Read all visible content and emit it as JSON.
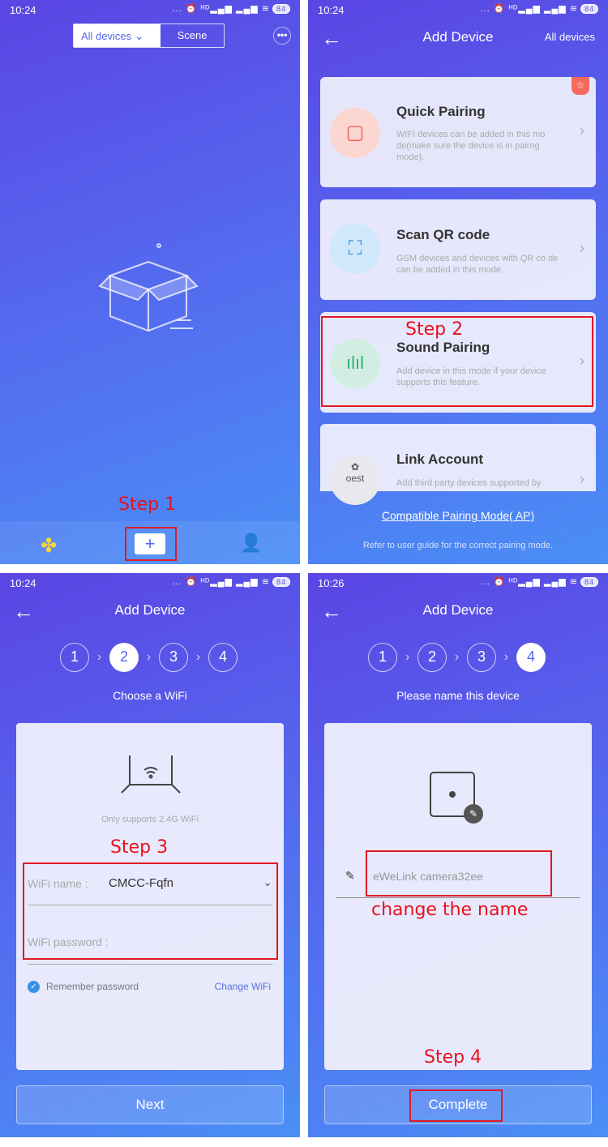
{
  "status_bars": [
    {
      "time": "10:24",
      "battery": "84"
    },
    {
      "time": "10:24",
      "battery": "84"
    },
    {
      "time": "10:24",
      "battery": "84"
    },
    {
      "time": "10:26",
      "battery": "84"
    }
  ],
  "status_icons": "... ⏰ ᴴᴰ▂▄▆ ▂▄▆ ≋",
  "home": {
    "tab_all_devices": "All devices",
    "tab_scene": "Scene",
    "more_icon": "more-icon",
    "add_label": "+",
    "annotation": "Step 1"
  },
  "add_device": {
    "title": "Add Device",
    "filter": "All devices",
    "cards": [
      {
        "title": "Quick Pairing",
        "desc": "WIFI devices can be added in this mo de(make sure the device is in pairng mode)."
      },
      {
        "title": "Scan QR code",
        "desc": "GSM devices and devices with QR co de can be added in this mode."
      },
      {
        "title": "Sound Pairing",
        "desc": "Add device in this mode if your device supports this feature."
      },
      {
        "title": "Link Account",
        "desc": "Add third party devices supported by",
        "logo_text": "oest"
      }
    ],
    "compatible_link": "Compatible Pairing Mode( AP)",
    "hint": "Refer to user guide for the correct pairing mode.",
    "annotation": "Step 2"
  },
  "wifi": {
    "title": "Add Device",
    "steps": [
      "1",
      "2",
      "3",
      "4"
    ],
    "active_step": 2,
    "subtitle": "Choose a WiFi",
    "support_note": "Only supports 2.4G WiFi",
    "name_label": "WiFi name :",
    "name_value": "CMCC-Fqfn",
    "password_label": "WiFi password :",
    "password_value": "",
    "remember": "Remember password",
    "remember_checked": true,
    "change_wifi": "Change WiFi",
    "next": "Next",
    "annotation": "Step 3"
  },
  "name": {
    "title": "Add Device",
    "steps": [
      "1",
      "2",
      "3",
      "4"
    ],
    "active_step": 4,
    "subtitle": "Please name this device",
    "device_name": "eWeLink camera32ee",
    "complete": "Complete",
    "annotation_name": "change the name",
    "annotation": "Step 4"
  },
  "colors": {
    "accent_red": "#e8121e",
    "gradient_top": "#5a45e3",
    "gradient_bottom": "#4a8ff6",
    "link_blue": "#5a6fe0"
  }
}
